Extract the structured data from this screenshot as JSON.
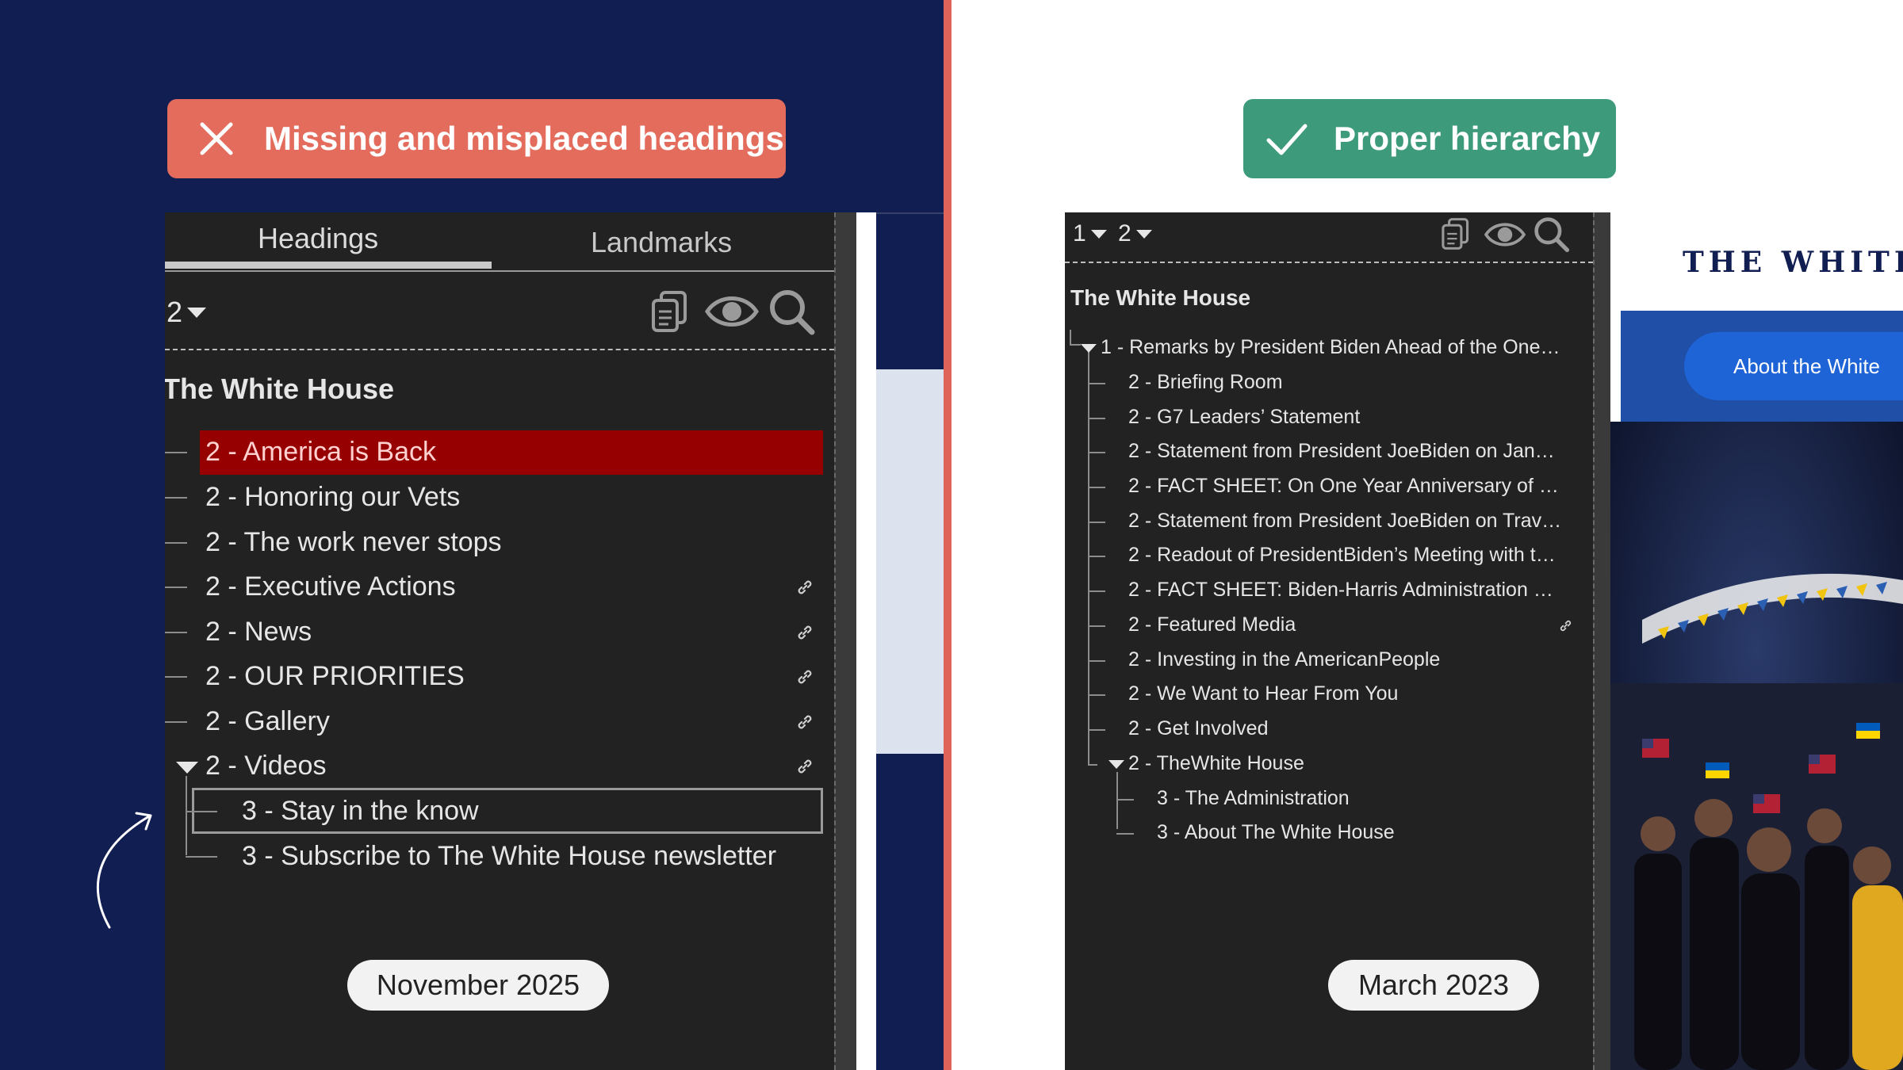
{
  "badges": {
    "bad": {
      "label": "Missing and misplaced headings",
      "color": "#e36c5c"
    },
    "good": {
      "label": "Proper hierarchy",
      "color": "#3d9b7c"
    }
  },
  "left_panel": {
    "tabs": [
      {
        "label": "Headings",
        "selected": true
      },
      {
        "label": "Landmarks",
        "selected": false
      }
    ],
    "level_filter": "2",
    "icons": [
      "copy-icon",
      "eye-icon",
      "search-icon"
    ],
    "page_title": "The White House",
    "headings": [
      {
        "label": "2 - America is Back",
        "state": "error-highlight",
        "link": false
      },
      {
        "label": "2 - Honoring our Vets",
        "link": false
      },
      {
        "label": "2 - The work never stops",
        "link": false
      },
      {
        "label": "2 - Executive Actions",
        "link": true
      },
      {
        "label": "2 - News",
        "link": true
      },
      {
        "label": "2 - OUR PRIORITIES",
        "link": true
      },
      {
        "label": "2 - Gallery",
        "link": true
      },
      {
        "label": "2 - Videos",
        "link": true,
        "expanded": true
      },
      {
        "label": "3 - Stay in the know",
        "state": "focused",
        "link": false
      },
      {
        "label": "3 - Subscribe to The White House newsletter",
        "link": false
      }
    ],
    "date": "November 2025",
    "highlight_color": "#960000"
  },
  "right_panel": {
    "level_filters": [
      "1",
      "2"
    ],
    "icons": [
      "copy-icon",
      "eye-icon",
      "search-icon"
    ],
    "page_title": "The White House",
    "headings": [
      {
        "label": "1 - Remarks by President Biden Ahead of the One…",
        "level": 1,
        "expanded": true
      },
      {
        "label": "2 - Briefing Room",
        "level": 2
      },
      {
        "label": "2 - G7 Leaders’ Statement",
        "level": 2
      },
      {
        "label": "2 - Statement from President JoeBiden on Jan…",
        "level": 2
      },
      {
        "label": "2 - FACT SHEET: On One Year Anniversary of …",
        "level": 2
      },
      {
        "label": "2 - Statement from President JoeBiden on Trav…",
        "level": 2
      },
      {
        "label": "2 - Readout of PresidentBiden’s Meeting with t…",
        "level": 2
      },
      {
        "label": "2 - FACT SHEET: Biden-Harris Administration …",
        "level": 2
      },
      {
        "label": "2 - Featured Media",
        "level": 2,
        "link": true
      },
      {
        "label": "2 - Investing in the AmericanPeople",
        "level": 2
      },
      {
        "label": "2 - We Want to Hear From You",
        "level": 2
      },
      {
        "label": "2 - Get Involved",
        "level": 2
      },
      {
        "label": "2 - TheWhite House",
        "level": 2,
        "expanded": true
      },
      {
        "label": "3 - The Administration",
        "level": 3
      },
      {
        "label": "3 - About The White House",
        "level": 3
      }
    ],
    "date": "March 2023"
  },
  "website": {
    "logo": "THE WHITE",
    "button": "About the White"
  }
}
